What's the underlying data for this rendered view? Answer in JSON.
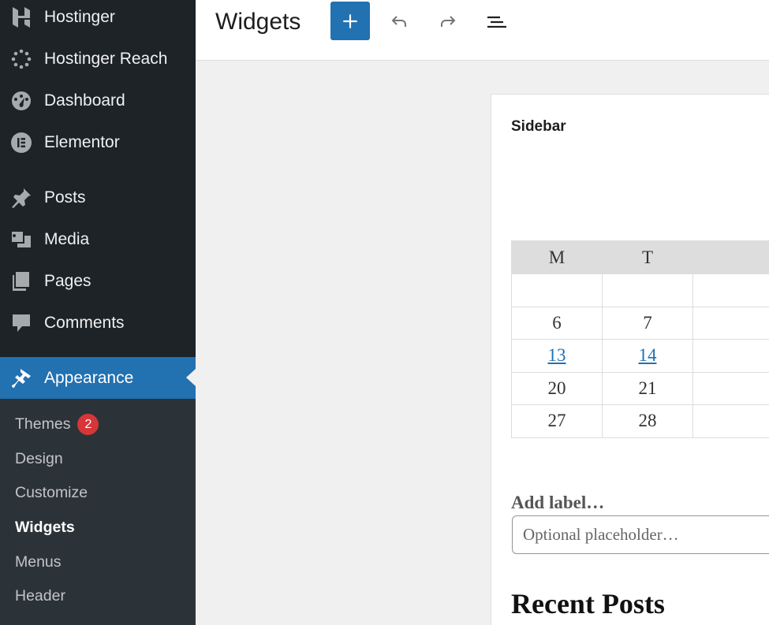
{
  "sidebar": {
    "menu": [
      {
        "label": "Hostinger",
        "icon": "hostinger-logo-icon"
      },
      {
        "label": "Hostinger Reach",
        "icon": "reach-spinner-icon"
      },
      {
        "label": "Dashboard",
        "icon": "dashboard-gauge-icon"
      },
      {
        "label": "Elementor",
        "icon": "elementor-icon"
      },
      {
        "label": "Posts",
        "icon": "pushpin-icon"
      },
      {
        "label": "Media",
        "icon": "media-icon"
      },
      {
        "label": "Pages",
        "icon": "pages-icon"
      },
      {
        "label": "Comments",
        "icon": "comment-bubble-icon"
      },
      {
        "label": "Appearance",
        "icon": "paintbrush-icon"
      }
    ],
    "submenu": [
      {
        "label": "Themes",
        "badge": "2"
      },
      {
        "label": "Design"
      },
      {
        "label": "Customize"
      },
      {
        "label": "Widgets"
      },
      {
        "label": "Menus"
      },
      {
        "label": "Header"
      }
    ]
  },
  "header": {
    "title": "Widgets",
    "add_icon": "plus-icon",
    "undo_icon": "undo-icon",
    "redo_icon": "redo-icon",
    "list_view_icon": "list-view-icon"
  },
  "editor": {
    "area_title": "Sidebar",
    "calendar": {
      "headers": [
        "M",
        "T"
      ],
      "rows": [
        [
          "",
          ""
        ],
        [
          "6",
          "7"
        ],
        [
          "13",
          "14"
        ],
        [
          "20",
          "21"
        ],
        [
          "27",
          "28"
        ]
      ],
      "linked": [
        "13",
        "14"
      ]
    },
    "search": {
      "label": "Add label…",
      "placeholder": "Optional placeholder…"
    },
    "recent_posts_title": "Recent Posts"
  },
  "colors": {
    "sidebar_bg": "#1d2327",
    "submenu_bg": "#2c3338",
    "accent": "#2271b1",
    "badge": "#d63638"
  }
}
